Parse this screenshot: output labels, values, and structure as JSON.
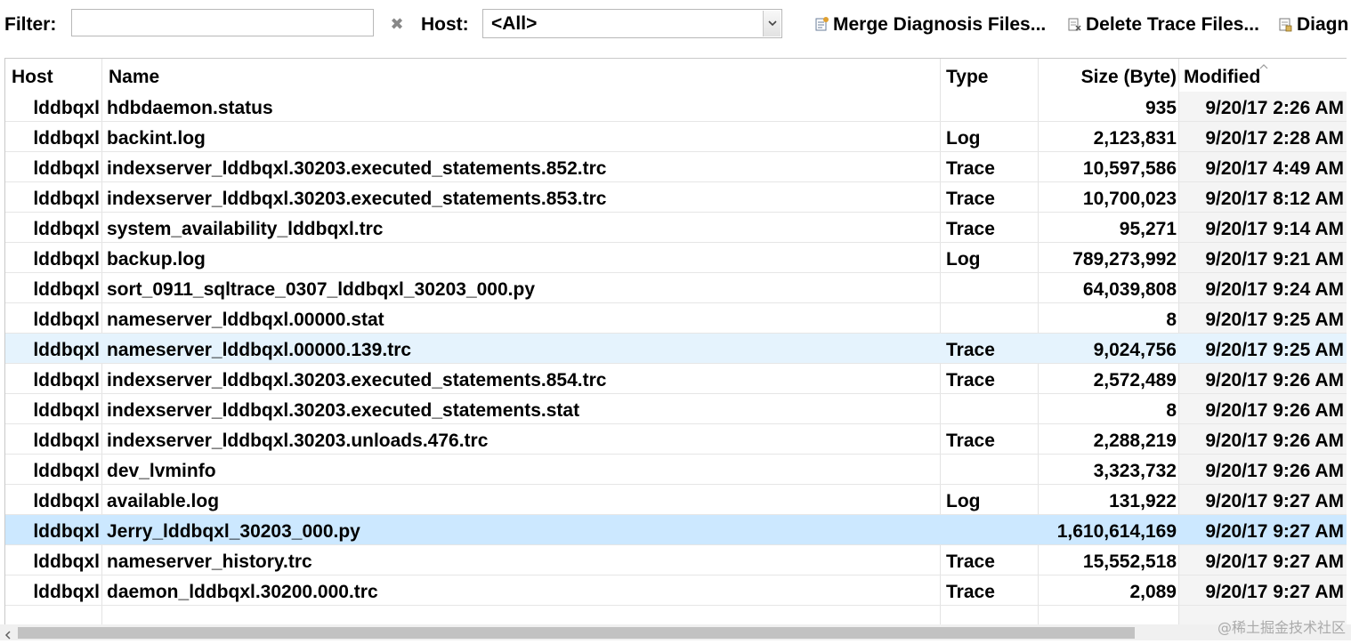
{
  "toolbar": {
    "filter_label": "Filter:",
    "filter_value": "",
    "host_label": "Host:",
    "host_selected": "<All>",
    "merge_label": "Merge Diagnosis Files...",
    "delete_label": "Delete Trace Files...",
    "diag_label": "Diagn"
  },
  "table": {
    "columns": {
      "host": "Host",
      "name": "Name",
      "type": "Type",
      "size": "Size (Byte)",
      "modified": "Modified"
    },
    "rows": [
      {
        "host": "lddbqxl",
        "name": "hdbdaemon.status",
        "type": "",
        "size": "935",
        "modified": "9/20/17 2:26 AM"
      },
      {
        "host": "lddbqxl",
        "name": "backint.log",
        "type": "Log",
        "size": "2,123,831",
        "modified": "9/20/17 2:28 AM"
      },
      {
        "host": "lddbqxl",
        "name": "indexserver_lddbqxl.30203.executed_statements.852.trc",
        "type": "Trace",
        "size": "10,597,586",
        "modified": "9/20/17 4:49 AM"
      },
      {
        "host": "lddbqxl",
        "name": "indexserver_lddbqxl.30203.executed_statements.853.trc",
        "type": "Trace",
        "size": "10,700,023",
        "modified": "9/20/17 8:12 AM"
      },
      {
        "host": "lddbqxl",
        "name": "system_availability_lddbqxl.trc",
        "type": "Trace",
        "size": "95,271",
        "modified": "9/20/17 9:14 AM"
      },
      {
        "host": "lddbqxl",
        "name": "backup.log",
        "type": "Log",
        "size": "789,273,992",
        "modified": "9/20/17 9:21 AM"
      },
      {
        "host": "lddbqxl",
        "name": "sort_0911_sqltrace_0307_lddbqxl_30203_000.py",
        "type": "",
        "size": "64,039,808",
        "modified": "9/20/17 9:24 AM"
      },
      {
        "host": "lddbqxl",
        "name": "nameserver_lddbqxl.00000.stat",
        "type": "",
        "size": "8",
        "modified": "9/20/17 9:25 AM"
      },
      {
        "host": "lddbqxl",
        "name": "nameserver_lddbqxl.00000.139.trc",
        "type": "Trace",
        "size": "9,024,756",
        "modified": "9/20/17 9:25 AM"
      },
      {
        "host": "lddbqxl",
        "name": "indexserver_lddbqxl.30203.executed_statements.854.trc",
        "type": "Trace",
        "size": "2,572,489",
        "modified": "9/20/17 9:26 AM"
      },
      {
        "host": "lddbqxl",
        "name": "indexserver_lddbqxl.30203.executed_statements.stat",
        "type": "",
        "size": "8",
        "modified": "9/20/17 9:26 AM"
      },
      {
        "host": "lddbqxl",
        "name": "indexserver_lddbqxl.30203.unloads.476.trc",
        "type": "Trace",
        "size": "2,288,219",
        "modified": "9/20/17 9:26 AM"
      },
      {
        "host": "lddbqxl",
        "name": "dev_lvminfo",
        "type": "",
        "size": "3,323,732",
        "modified": "9/20/17 9:26 AM"
      },
      {
        "host": "lddbqxl",
        "name": "available.log",
        "type": "Log",
        "size": "131,922",
        "modified": "9/20/17 9:27 AM"
      },
      {
        "host": "lddbqxl",
        "name": "Jerry_lddbqxl_30203_000.py",
        "type": "",
        "size": "1,610,614,169",
        "modified": "9/20/17 9:27 AM"
      },
      {
        "host": "lddbqxl",
        "name": "nameserver_history.trc",
        "type": "Trace",
        "size": "15,552,518",
        "modified": "9/20/17 9:27 AM"
      },
      {
        "host": "lddbqxl",
        "name": "daemon_lddbqxl.30200.000.trc",
        "type": "Trace",
        "size": "2,089",
        "modified": "9/20/17 9:27 AM"
      }
    ],
    "hovered_row": 8,
    "selected_row": 14,
    "sort_column": "modified",
    "sort_direction": "ascending"
  },
  "watermark": "@稀土掘金技术社区",
  "icons": {
    "clear": "clear-filter-icon",
    "dropdown": "chevron-down-icon",
    "merge": "merge-files-icon",
    "delete": "delete-trace-icon",
    "diag": "diagnosis-icon",
    "sort": "sort-ascending-icon"
  },
  "colors": {
    "hover_row": "#e5f3fd",
    "selected_row": "#cce8ff",
    "sorted_column_bg": "#f4f4f4"
  }
}
